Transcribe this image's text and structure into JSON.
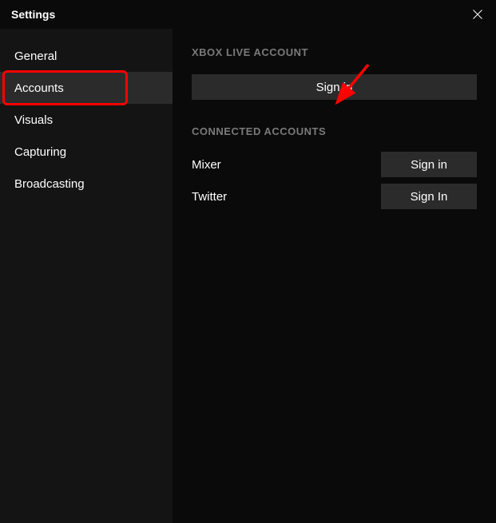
{
  "window": {
    "title": "Settings"
  },
  "sidebar": {
    "items": [
      {
        "label": "General",
        "active": false
      },
      {
        "label": "Accounts",
        "active": true
      },
      {
        "label": "Visuals",
        "active": false
      },
      {
        "label": "Capturing",
        "active": false
      },
      {
        "label": "Broadcasting",
        "active": false
      }
    ]
  },
  "content": {
    "xbox_section_header": "XBOX LIVE ACCOUNT",
    "xbox_signin_label": "Sign in",
    "connected_section_header": "CONNECTED ACCOUNTS",
    "accounts": [
      {
        "name": "Mixer",
        "button": "Sign in"
      },
      {
        "name": "Twitter",
        "button": "Sign In"
      }
    ]
  }
}
